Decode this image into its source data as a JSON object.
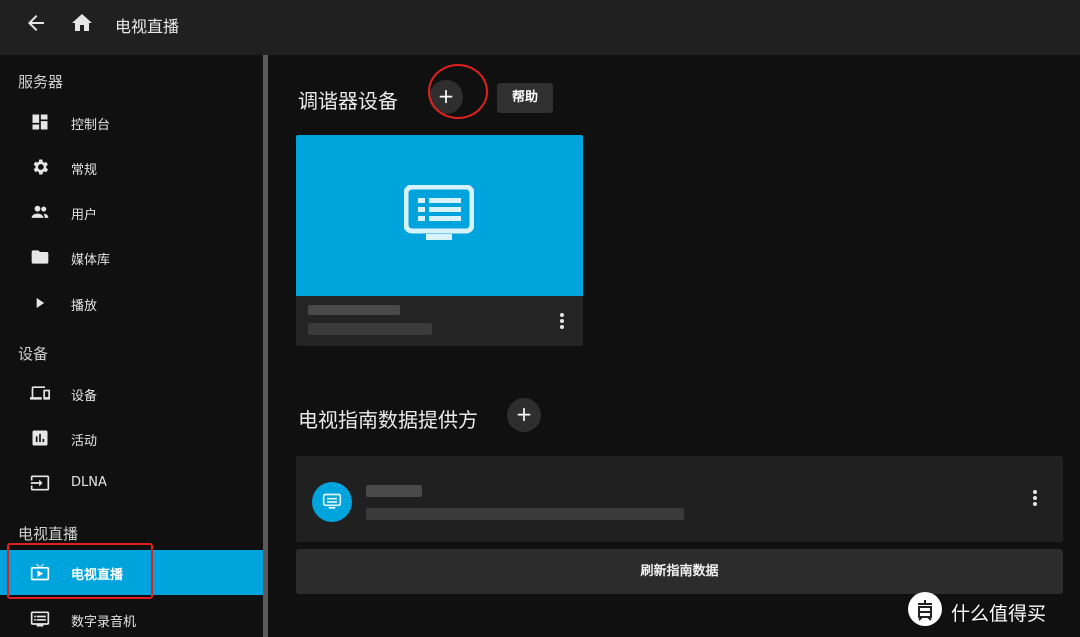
{
  "header": {
    "title": "电视直播",
    "back_icon": "arrow-left-icon",
    "home_icon": "home-icon"
  },
  "sidebar": {
    "sections": [
      {
        "title": "服务器",
        "items": [
          {
            "label": "控制台",
            "icon": "dashboard-icon"
          },
          {
            "label": "常规",
            "icon": "gear-icon"
          },
          {
            "label": "用户",
            "icon": "people-icon"
          },
          {
            "label": "媒体库",
            "icon": "folder-icon"
          },
          {
            "label": "播放",
            "icon": "play-icon"
          }
        ]
      },
      {
        "title": "设备",
        "items": [
          {
            "label": "设备",
            "icon": "devices-icon"
          },
          {
            "label": "活动",
            "icon": "activity-chart-icon"
          },
          {
            "label": "DLNA",
            "icon": "input-icon"
          }
        ]
      },
      {
        "title": "电视直播",
        "items": [
          {
            "label": "电视直播",
            "icon": "live-tv-icon",
            "active": true
          },
          {
            "label": "数字录音机",
            "icon": "dvr-icon"
          }
        ]
      }
    ]
  },
  "main": {
    "tuners": {
      "title": "调谐器设备",
      "add_label": "+",
      "help_label": "帮助",
      "card_icon": "tv-guide-icon",
      "card_color": "#00a4dc"
    },
    "guide": {
      "title": "电视指南数据提供方",
      "add_label": "+",
      "refresh_label": "刷新指南数据"
    }
  },
  "watermark": {
    "text": "什么值得买",
    "logo_text": "值"
  },
  "colors": {
    "accent": "#00a4dc",
    "highlight_outline": "#e0201e"
  }
}
